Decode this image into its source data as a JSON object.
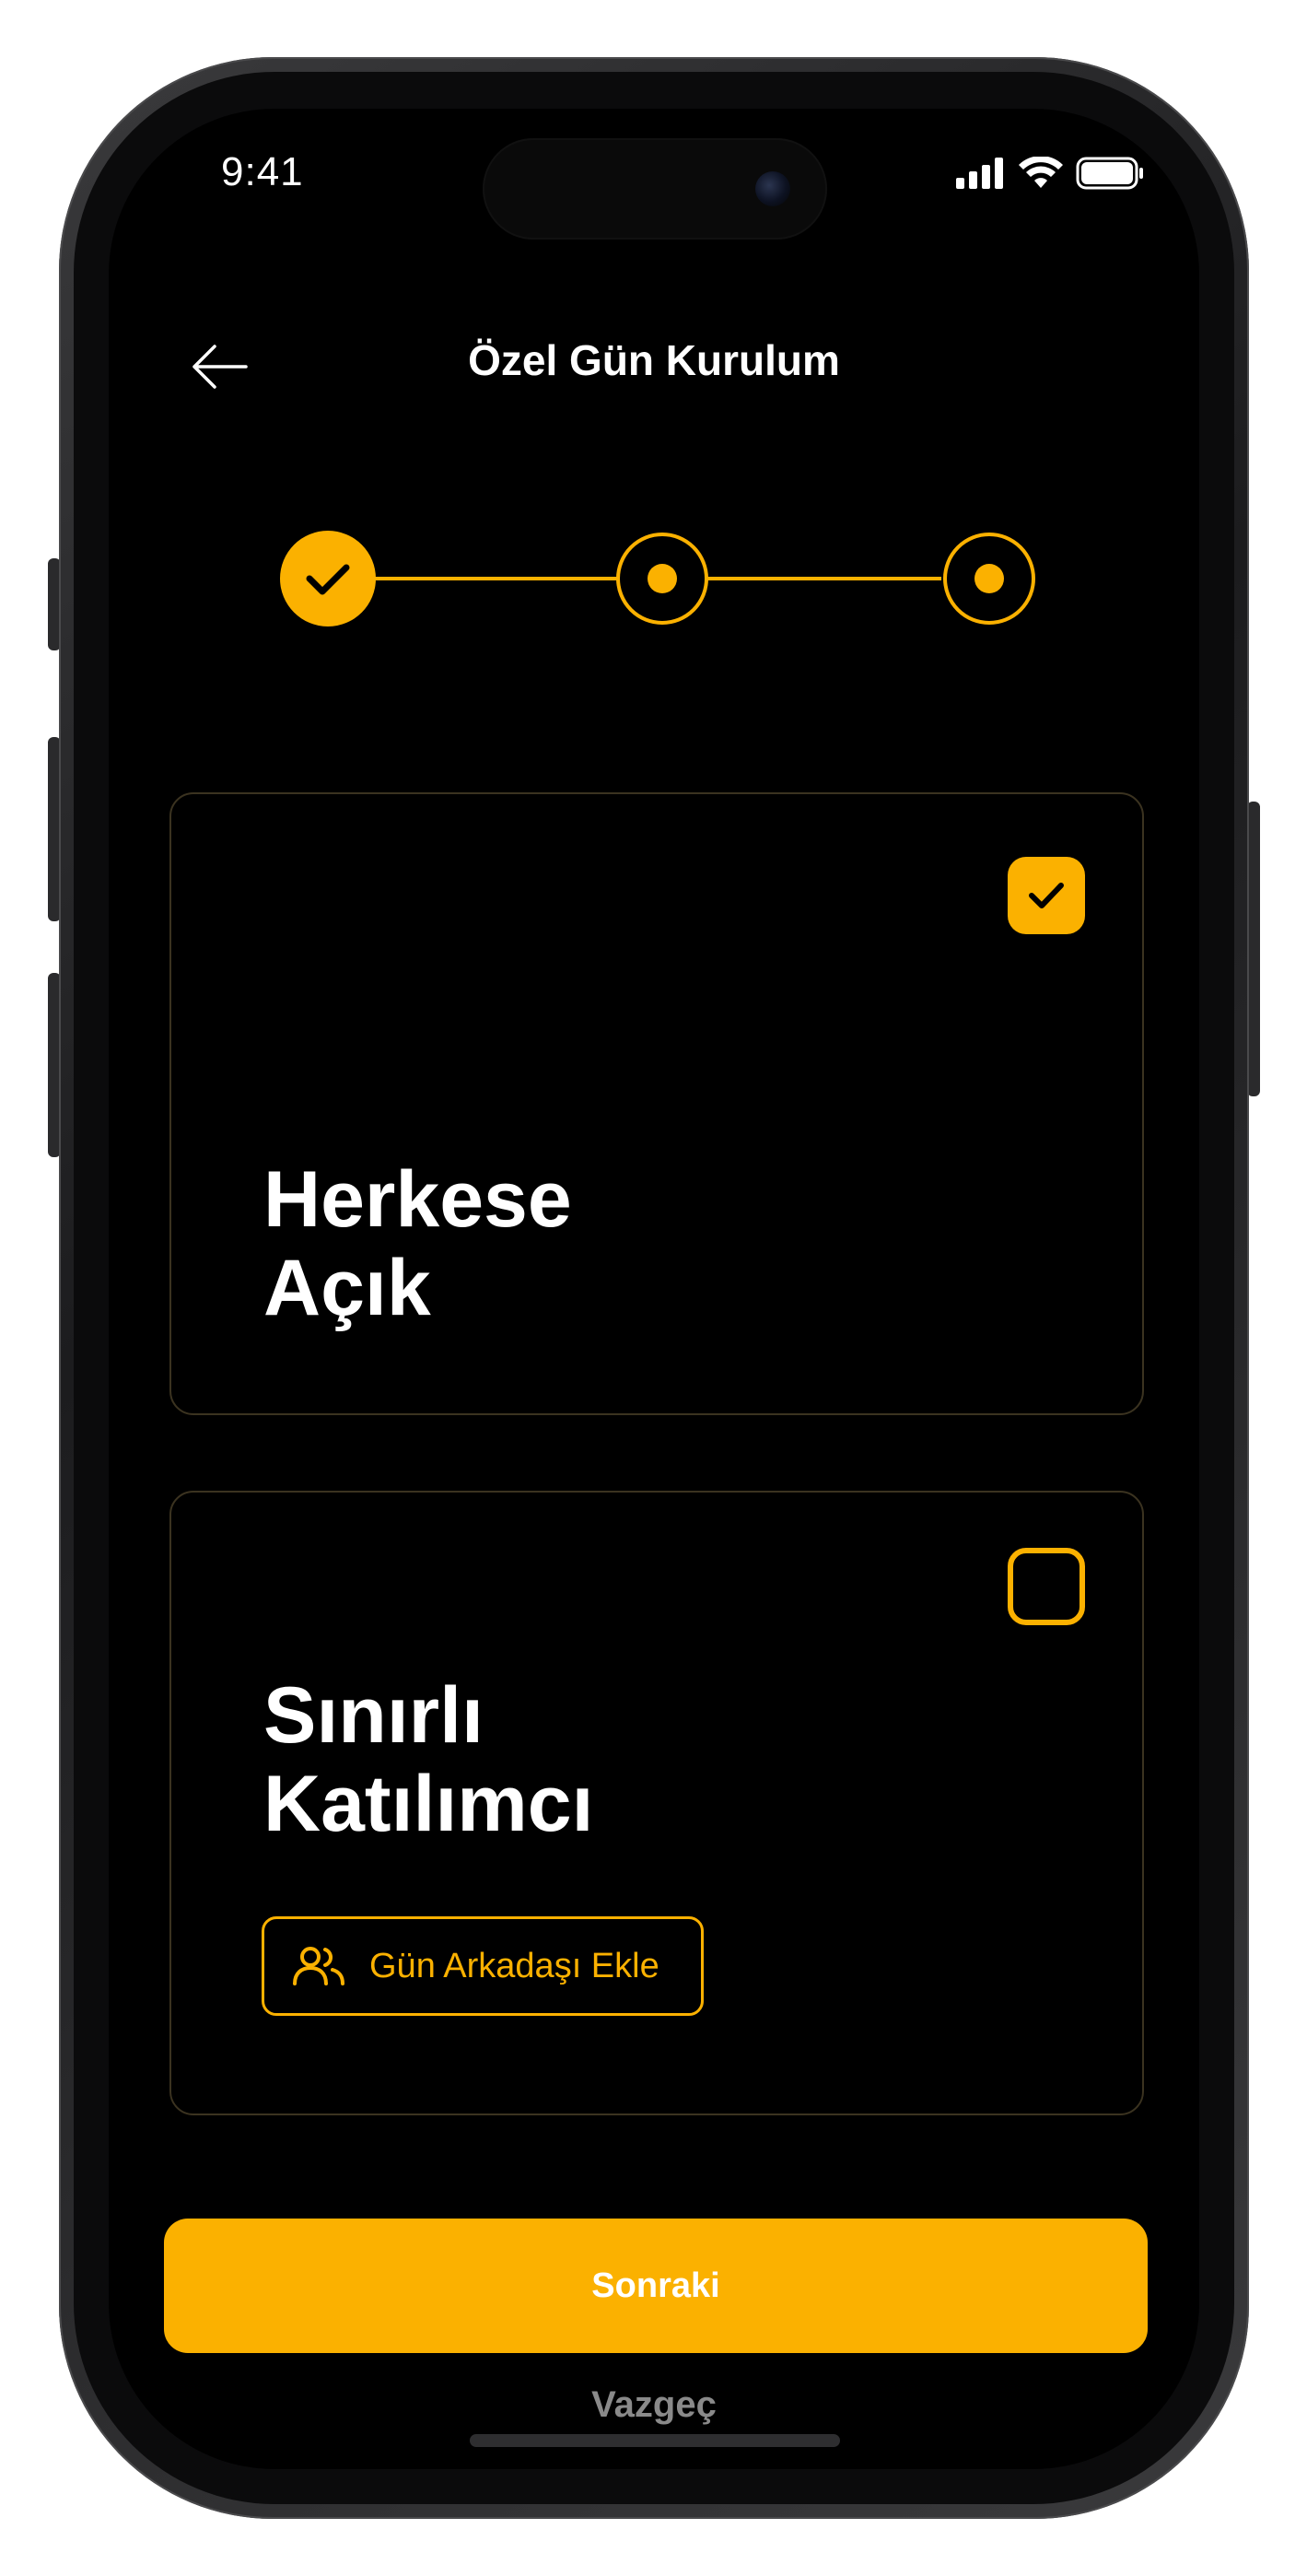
{
  "status_bar": {
    "time": "9:41",
    "signal_icon": "cellular-signal-icon",
    "wifi_icon": "wifi-icon",
    "battery_icon": "battery-icon"
  },
  "header": {
    "back_icon": "arrow-left-icon",
    "title": "Özel Gün Kurulum"
  },
  "stepper": {
    "steps": [
      {
        "state": "completed",
        "icon": "check-icon"
      },
      {
        "state": "active",
        "icon": "dot-icon"
      },
      {
        "state": "active",
        "icon": "dot-icon"
      }
    ]
  },
  "options": [
    {
      "title_line1": "Herkese",
      "title_line2": "Açık",
      "selected": true
    },
    {
      "title_line1": "Sınırlı",
      "title_line2": "Katılımcı",
      "selected": false,
      "action_label": "Gün Arkadaşı Ekle",
      "action_icon": "users-icon"
    }
  ],
  "actions": {
    "next_label": "Sonraki",
    "cancel_label": "Vazgeç"
  },
  "colors": {
    "accent": "#fbb100",
    "background": "#000000",
    "text": "#ffffff",
    "muted": "#8a8a8a",
    "card_border": "#3b3320"
  }
}
